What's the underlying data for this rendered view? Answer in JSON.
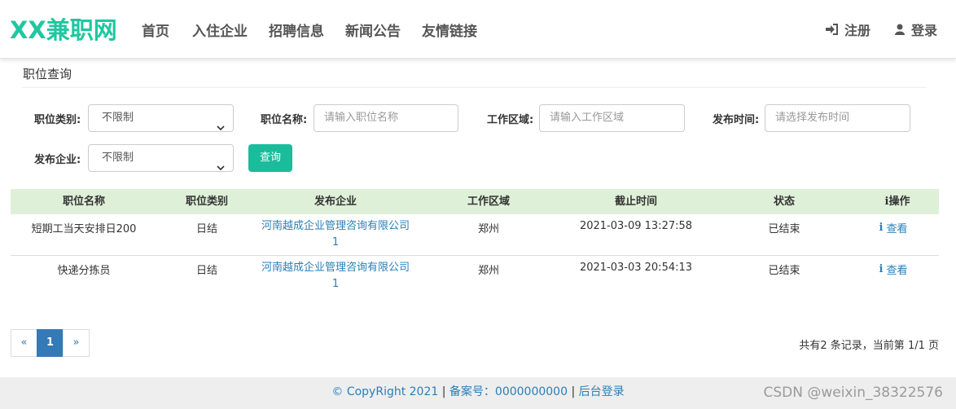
{
  "header": {
    "logo": "XX兼职网",
    "nav": [
      "首页",
      "入住企业",
      "招聘信息",
      "新闻公告",
      "友情链接"
    ],
    "register": "注册",
    "login": "登录"
  },
  "search": {
    "title": "职位查询",
    "category_label": "职位类别:",
    "category_value": "不限制",
    "name_label": "职位名称:",
    "name_placeholder": "请输入职位名称",
    "area_label": "工作区域:",
    "area_placeholder": "请输入工作区域",
    "time_label": "发布时间:",
    "time_placeholder": "请选择发布时间",
    "company_label": "发布企业:",
    "company_value": "不限制",
    "query_button": "查询"
  },
  "table": {
    "headers": [
      "职位名称",
      "职位类别",
      "发布企业",
      "工作区域",
      "截止时间",
      "状态",
      "操作"
    ],
    "rows": [
      {
        "name": "短期工当天安排日200",
        "category": "日结",
        "company": "河南越成企业管理咨询有限公司1",
        "area": "郑州",
        "deadline": "2021-03-09 13:27:58",
        "status": "已结束",
        "action": "查看"
      },
      {
        "name": "快递分拣员",
        "category": "日结",
        "company": "河南越成企业管理咨询有限公司1",
        "area": "郑州",
        "deadline": "2021-03-03 20:54:13",
        "status": "已结束",
        "action": "查看"
      }
    ]
  },
  "pagination": {
    "prev": "«",
    "current": "1",
    "next": "»",
    "info": "共有2 条记录，当前第 1/1 页"
  },
  "footer": {
    "copyright": "© CopyRight 2021",
    "beian": "备案号：0000000000",
    "admin": "后台登录"
  },
  "watermark": "CSDN @weixin_38322576",
  "colors": {
    "brand": "#1ec8a0",
    "button": "#1abc9c",
    "link": "#2a7fb8",
    "table_header": "#dff0d8",
    "active_page": "#337ab7"
  }
}
